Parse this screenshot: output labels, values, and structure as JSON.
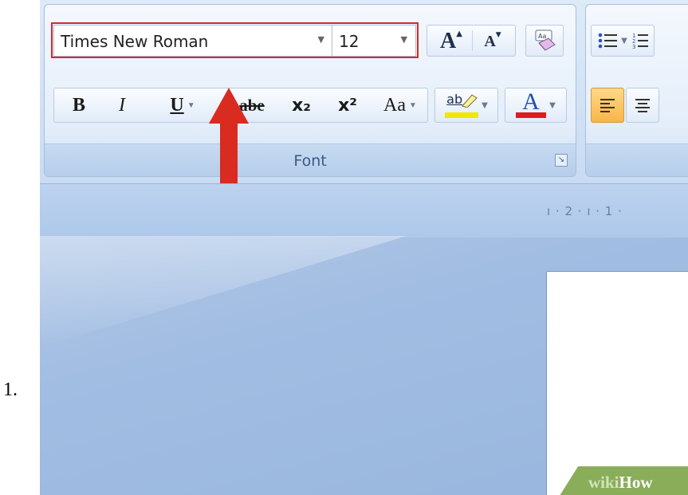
{
  "step": {
    "number": "1."
  },
  "ribbon": {
    "font_group": {
      "label": "Font",
      "font_name": "Times New Roman",
      "font_size": "12",
      "grow_font_label": "A",
      "shrink_font_label": "A",
      "bold_label": "B",
      "italic_label": "I",
      "underline_label": "U",
      "strikethrough_label": "abe",
      "subscript_label": "x₂",
      "superscript_label": "x²",
      "change_case_label": "Aa",
      "highlight_label": "ab",
      "font_color_label": "A",
      "highlight_color": "#f2e600",
      "font_color": "#e01b1b"
    }
  },
  "annotation": {
    "highlight_color": "#d42a2a",
    "arrow_color": "#d92b20"
  },
  "document": {
    "ruler_text": "ı · 2 · ı · 1 ·"
  },
  "watermark": {
    "prefix": "wiki",
    "suffix": "How"
  }
}
